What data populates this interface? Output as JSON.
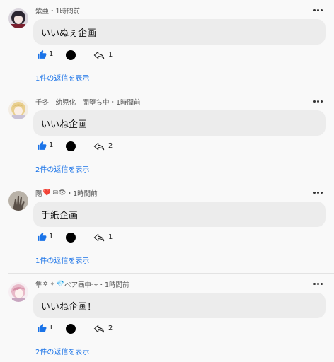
{
  "colors": {
    "link": "#1a73e8",
    "like": "#1a73e8",
    "bubble": "#ececec"
  },
  "comments": [
    {
      "author": "紫亜",
      "author_emoji": "",
      "meta": "・1時間前",
      "text": "いいぬぇ企画",
      "likes": "1",
      "replies": "1",
      "view_replies": "1件の返信を表示",
      "avatar": "dark-hair-avatar"
    },
    {
      "author": "千冬　幼児化　闇堕ち中",
      "author_emoji": "",
      "meta": "・1時間前",
      "text": "いいね企画",
      "likes": "1",
      "replies": "2",
      "view_replies": "2件の返信を表示",
      "avatar": "blonde-avatar"
    },
    {
      "author": "陽",
      "author_emoji": "❤️ ✉👁",
      "meta": "・1時間前",
      "text": "手紙企画",
      "likes": "1",
      "replies": "1",
      "view_replies": "1件の返信を表示",
      "avatar": "hand-avatar"
    },
    {
      "author": "隼",
      "author_emoji": "✡ ⟡ 💎",
      "meta": "ペア画中〜・1時間前",
      "text": "いいね企画！",
      "likes": "1",
      "replies": "2",
      "view_replies": "2件の返信を表示",
      "avatar": "pink-hair-avatar"
    }
  ]
}
